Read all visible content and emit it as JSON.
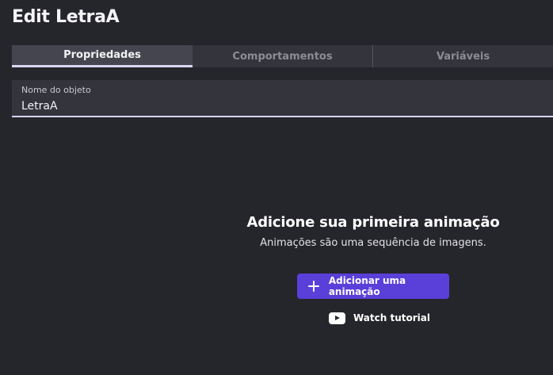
{
  "dialog": {
    "title": "Edit LetraA"
  },
  "tabs": [
    {
      "label": "Propriedades",
      "active": true
    },
    {
      "label": "Comportamentos",
      "active": false
    },
    {
      "label": "Variáveis",
      "active": false
    }
  ],
  "object_name": {
    "label": "Nome do objeto",
    "value": "LetraA"
  },
  "empty_state": {
    "title": "Adicione sua primeira animação",
    "description": "Animações são uma sequência de imagens.",
    "add_button": {
      "label": "Adicionar uma animação",
      "icon": "plus-icon"
    },
    "tutorial_link": {
      "label": "Watch tutorial",
      "icon": "youtube-icon"
    }
  },
  "colors": {
    "background": "#25252c",
    "accent": "#5b3fd9",
    "active_tab_underline": "#d8d6f2"
  }
}
